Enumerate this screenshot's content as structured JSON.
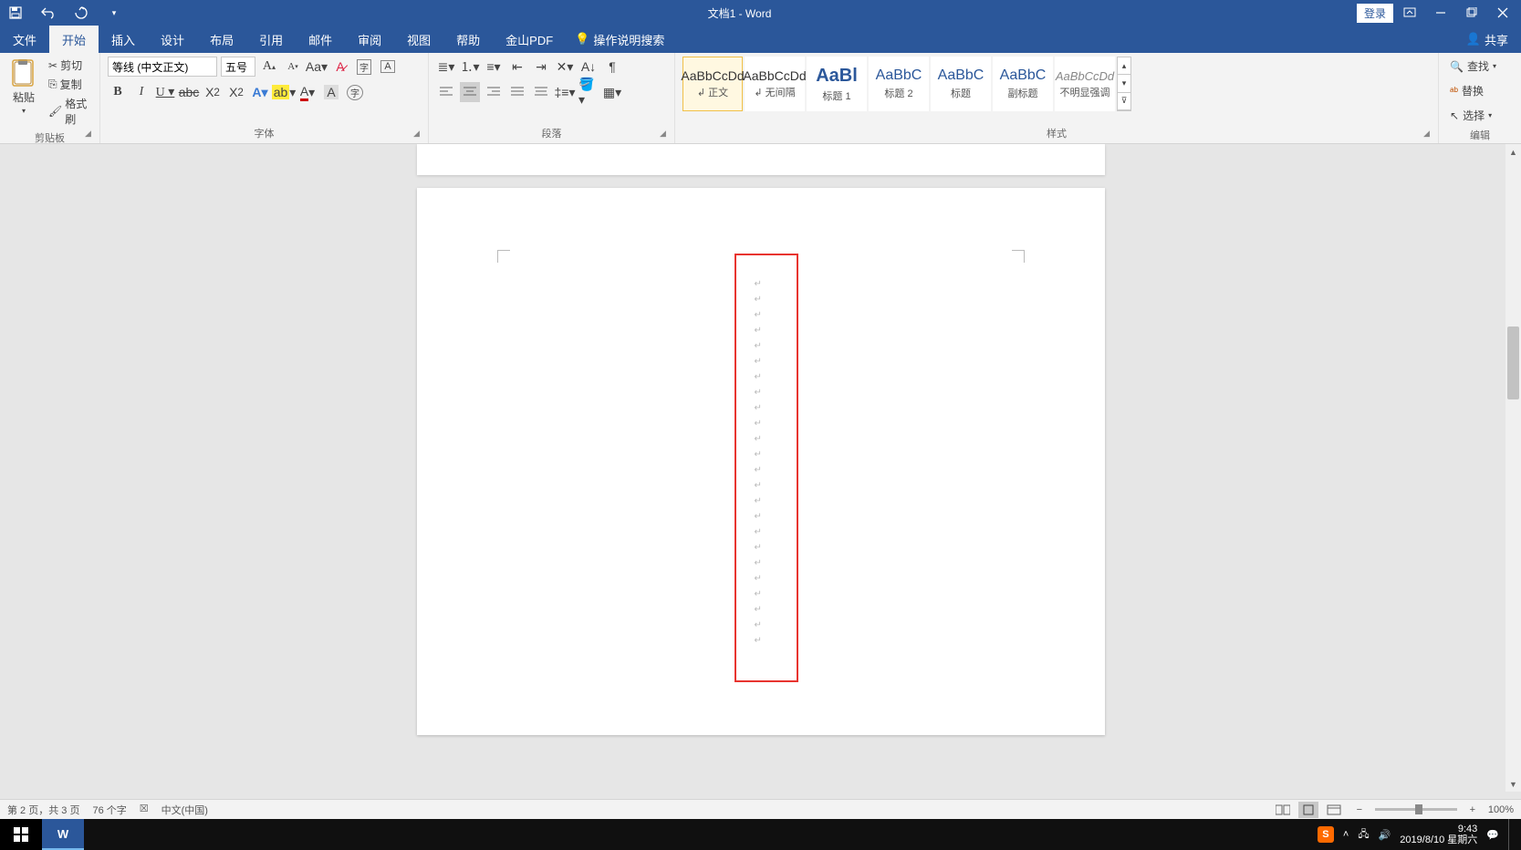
{
  "titlebar": {
    "title": "文档1 - Word",
    "login": "登录"
  },
  "tabs": {
    "file": "文件",
    "home": "开始",
    "insert": "插入",
    "design": "设计",
    "layout": "布局",
    "references": "引用",
    "mailings": "邮件",
    "review": "审阅",
    "view": "视图",
    "help": "帮助",
    "jinshan": "金山PDF",
    "tell_me": "操作说明搜索",
    "share": "共享"
  },
  "ribbon": {
    "clipboard": {
      "paste": "粘贴",
      "cut": "剪切",
      "copy": "复制",
      "format_painter": "格式刷",
      "label": "剪贴板"
    },
    "font": {
      "name": "等线 (中文正文)",
      "size": "五号",
      "label": "字体"
    },
    "paragraph": {
      "label": "段落"
    },
    "styles": {
      "label": "样式",
      "items": [
        {
          "preview": "AaBbCcDd",
          "name": "↲ 正文",
          "cls": ""
        },
        {
          "preview": "AaBbCcDd",
          "name": "↲ 无间隔",
          "cls": ""
        },
        {
          "preview": "AaBl",
          "name": "标题 1",
          "cls": "big"
        },
        {
          "preview": "AaBbC",
          "name": "标题 2",
          "cls": "med"
        },
        {
          "preview": "AaBbC",
          "name": "标题",
          "cls": "med"
        },
        {
          "preview": "AaBbC",
          "name": "副标题",
          "cls": "med"
        },
        {
          "preview": "AaBbCcDd",
          "name": "不明显强调",
          "cls": "light"
        }
      ]
    },
    "editing": {
      "find": "查找",
      "replace": "替换",
      "select": "选择",
      "label": "编辑"
    }
  },
  "statusbar": {
    "page": "第 2 页，共 3 页",
    "words": "76 个字",
    "lang": "中文(中国)",
    "zoom": "100%"
  },
  "taskbar": {
    "time": "9:43",
    "date": "2019/8/10 星期六"
  }
}
